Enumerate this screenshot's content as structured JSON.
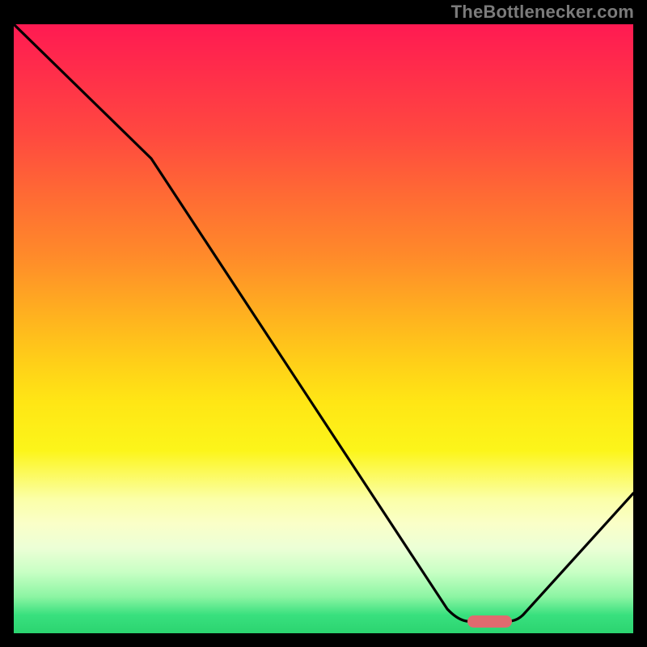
{
  "attribution": "TheBottlenecker.com",
  "chart_data": {
    "type": "line",
    "title": "",
    "xlabel": "",
    "ylabel": "",
    "xlim": [
      0,
      100
    ],
    "ylim": [
      0,
      100
    ],
    "series": [
      {
        "name": "bottleneck-curve",
        "x": [
          0,
          22,
          70,
          74,
          80,
          100
        ],
        "values": [
          100,
          78,
          4,
          2,
          2,
          23
        ]
      }
    ],
    "marker": {
      "x_start": 74,
      "x_end": 80,
      "y": 2,
      "color": "#e06a6f"
    },
    "gradient_stops": [
      {
        "pos": 0,
        "color": "#ff1a52"
      },
      {
        "pos": 70,
        "color": "#fcf51a"
      },
      {
        "pos": 100,
        "color": "#2bd470"
      }
    ]
  }
}
